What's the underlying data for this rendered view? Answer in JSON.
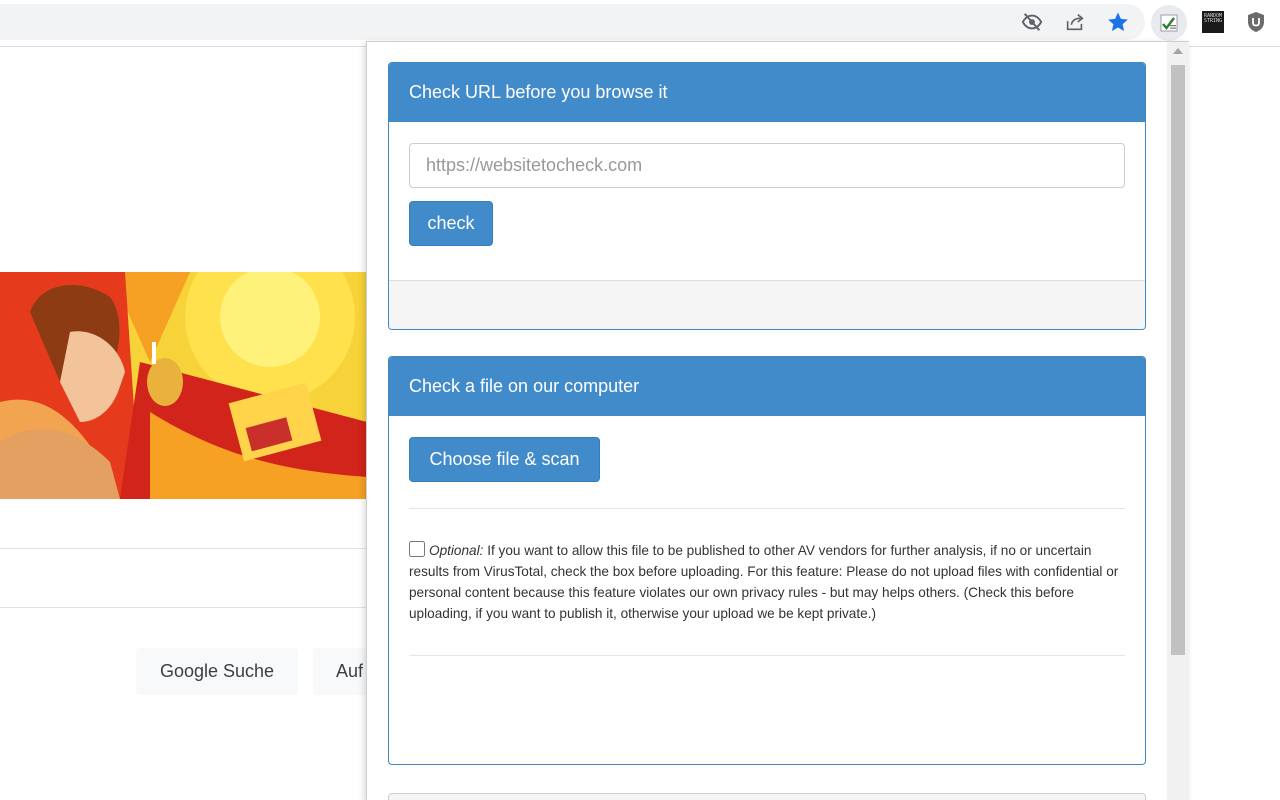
{
  "colors": {
    "primary": "#428bca",
    "star": "#1a73e8"
  },
  "toolbar": {
    "icons": [
      "eye-off-icon",
      "share-icon",
      "star-icon",
      "extension-check-icon",
      "extension-thumbnail-icon",
      "ublock-shield-icon"
    ],
    "thumbnail_text": "RANDOM STRING"
  },
  "google": {
    "search_button": "Google Suche",
    "lucky_button": "Auf"
  },
  "url_panel": {
    "title": "Check URL before you browse it",
    "input_placeholder": "https://websitetocheck.com",
    "check_button": "check"
  },
  "file_panel": {
    "title": "Check a file on our computer",
    "scan_button": "Choose file & scan",
    "optional_label": "Optional:",
    "optional_text": "If you want to allow this file to be published to other AV vendors for further analysis, if no or uncertain results from VirusTotal, check the box before uploading. For this feature: Please do not upload files with confidential or personal content because this feature violates our own privacy rules - but may helps others. (Check this before uploading, if you want to publish it, otherwise your upload we be kept private.)"
  }
}
